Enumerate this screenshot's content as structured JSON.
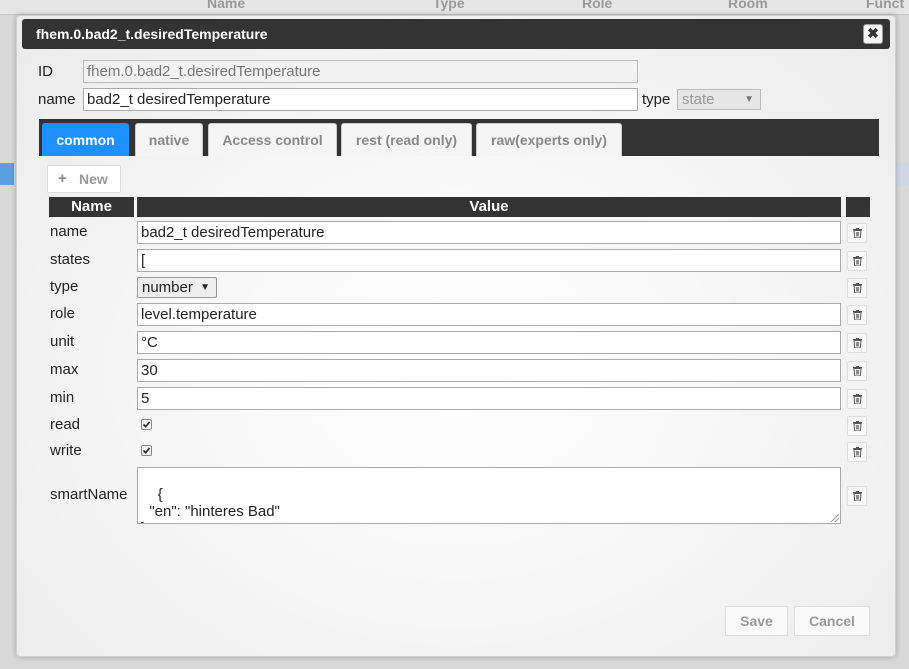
{
  "background": {
    "columns": [
      "Name",
      "Type",
      "Role",
      "Room",
      "Funct"
    ]
  },
  "dialog": {
    "title": "fhem.0.bad2_t.desiredTemperature",
    "close_glyph": "✖",
    "id_label": "ID",
    "id_value": "fhem.0.bad2_t.desiredTemperature",
    "name_label": "name",
    "name_value": "bad2_t desiredTemperature",
    "type_label": "type",
    "type_value": "state"
  },
  "tabs": [
    {
      "label": "common",
      "active": true
    },
    {
      "label": "native",
      "active": false
    },
    {
      "label": "Access control",
      "active": false
    },
    {
      "label": "rest (read only)",
      "active": false
    },
    {
      "label": "raw(experts only)",
      "active": false
    }
  ],
  "new_button": {
    "icon": "plus-icon",
    "label": "New"
  },
  "table": {
    "headers": [
      "Name",
      "Value",
      ""
    ],
    "rows": {
      "name": {
        "label": "name",
        "value": "bad2_t desiredTemperature"
      },
      "states": {
        "label": "states",
        "value": "["
      },
      "type": {
        "label": "type",
        "value": "number"
      },
      "role": {
        "label": "role",
        "value": "level.temperature"
      },
      "unit": {
        "label": "unit",
        "value": "°C"
      },
      "max": {
        "label": "max",
        "value": "30"
      },
      "min": {
        "label": "min",
        "value": "5"
      },
      "read": {
        "label": "read",
        "checked": true
      },
      "write": {
        "label": "write",
        "checked": true
      },
      "smartName": {
        "label": "smartName",
        "value": "{\n  \"en\": \"hinteres Bad\"\n}"
      }
    },
    "delete_icon": "trash-icon"
  },
  "footer": {
    "save_label": "Save",
    "cancel_label": "Cancel"
  },
  "colors": {
    "accent": "#1e90ff",
    "titlebar": "#333333"
  }
}
